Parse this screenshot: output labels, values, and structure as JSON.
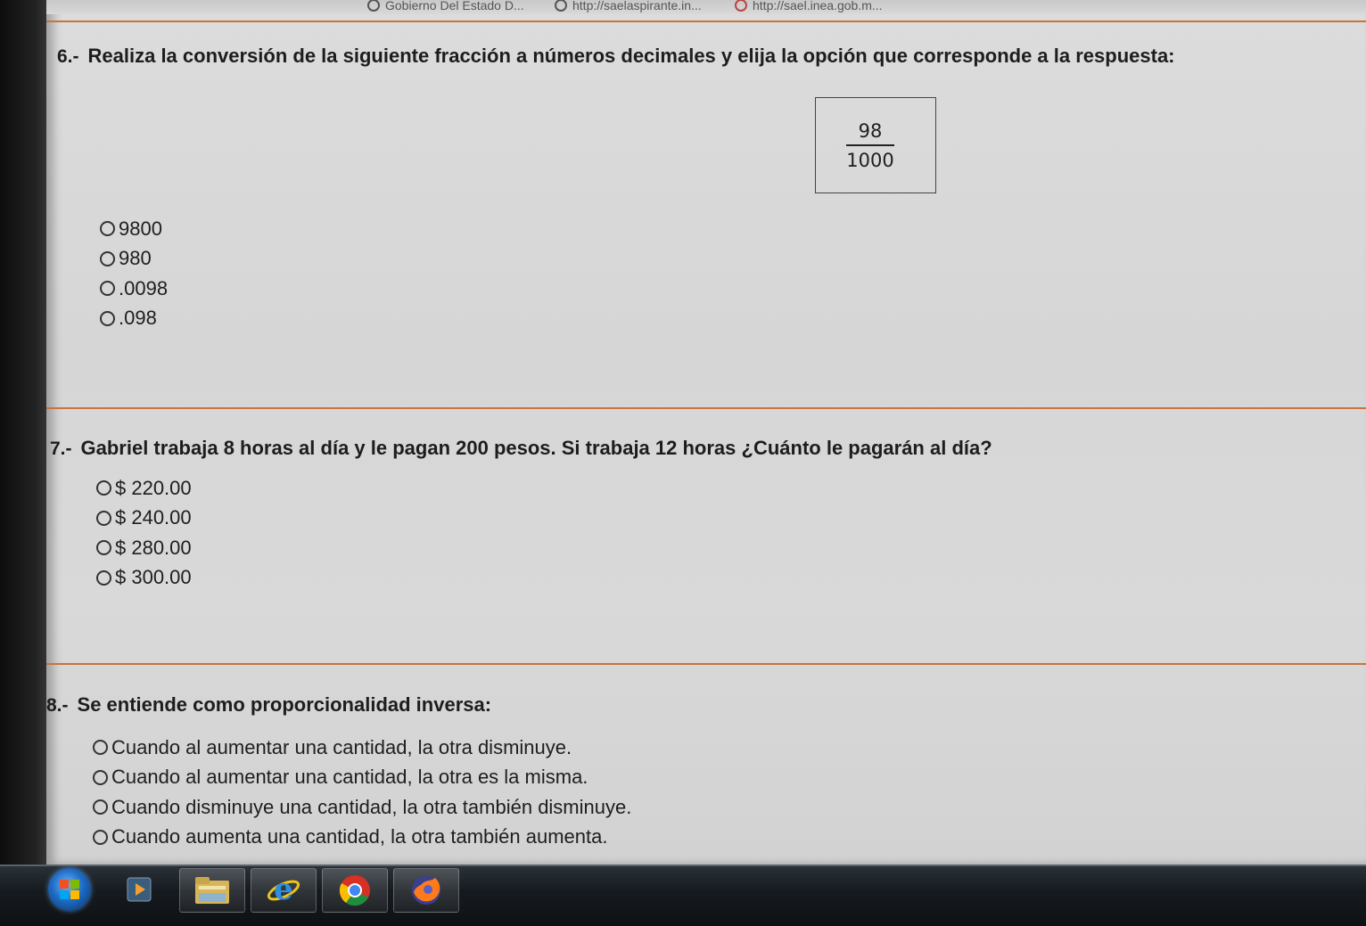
{
  "browser": {
    "bookmarks": [
      "Gobierno Del Estado D...",
      "http://saelaspirante.in...",
      "http://sael.inea.gob.m..."
    ]
  },
  "questions": [
    {
      "number": "6.-",
      "text": "Realiza la conversión de la siguiente fracción a números decimales y elija la opción que corresponde a la respuesta:",
      "fraction": {
        "numerator": "98",
        "denominator": "1000"
      },
      "options": [
        "9800",
        "980",
        ".0098",
        ".098"
      ]
    },
    {
      "number": "7.-",
      "text": "Gabriel trabaja 8 horas al día y le pagan 200 pesos. Si trabaja 12 horas ¿Cuánto le pagarán al día?",
      "options": [
        "$ 220.00",
        "$ 240.00",
        "$ 280.00",
        "$ 300.00"
      ]
    },
    {
      "number": "8.-",
      "text": "Se entiende como proporcionalidad inversa:",
      "options": [
        "Cuando al aumentar una cantidad, la otra disminuye.",
        "Cuando al aumentar una cantidad, la otra es la misma.",
        "Cuando disminuye una cantidad, la otra también disminuye.",
        "Cuando aumenta una cantidad, la otra también aumenta."
      ]
    }
  ],
  "colors": {
    "separator": "#c8743a",
    "page_background": "#d8d8d8"
  },
  "taskbar": {
    "items": [
      "start-orb-icon",
      "media-player-icon",
      "file-explorer-icon",
      "internet-explorer-icon",
      "chrome-icon",
      "firefox-icon"
    ]
  }
}
